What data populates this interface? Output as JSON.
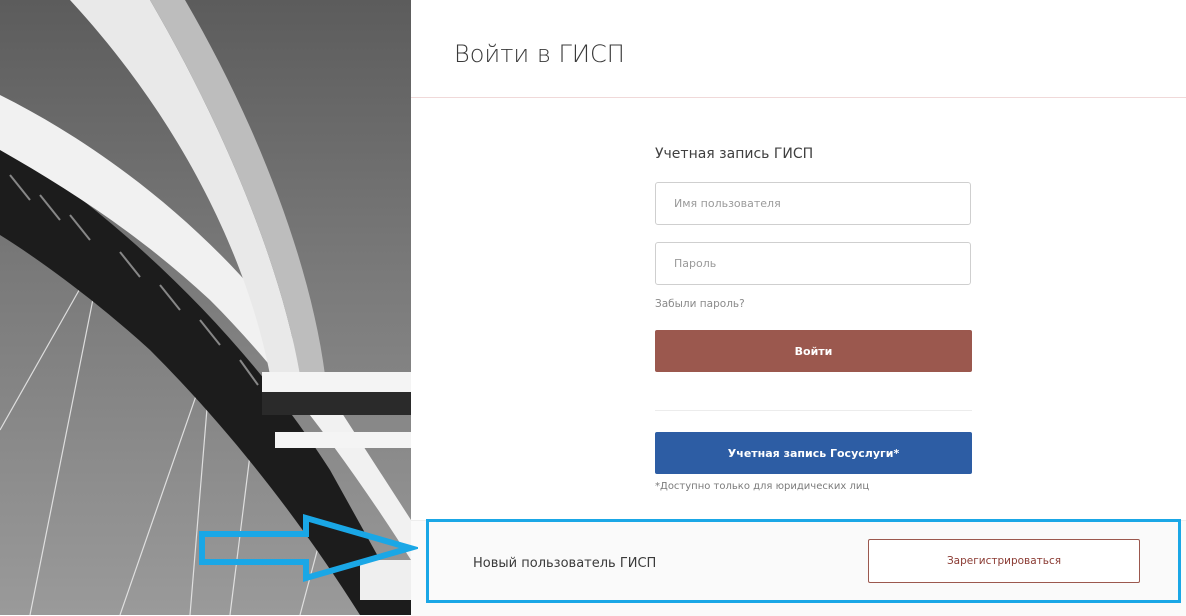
{
  "page": {
    "title": "Войти в ГИСП"
  },
  "login": {
    "section_title": "Учетная запись ГИСП",
    "username_placeholder": "Имя пользователя",
    "password_placeholder": "Пароль",
    "forgot_label": "Забыли пароль?",
    "submit_label": "Войти"
  },
  "gosuslugi": {
    "button_label": "Учетная запись Госуслуги*",
    "note": "*Доступно только для юридических лиц"
  },
  "register": {
    "label": "Новый пользователь ГИСП",
    "button_label": "Зарегистрироваться"
  },
  "colors": {
    "login_button": "#9b584e",
    "gosuslugi_button": "#2d5da4",
    "annotation": "#1aa7e6"
  },
  "icons": {
    "annotation_arrow": "arrow-right-icon"
  }
}
